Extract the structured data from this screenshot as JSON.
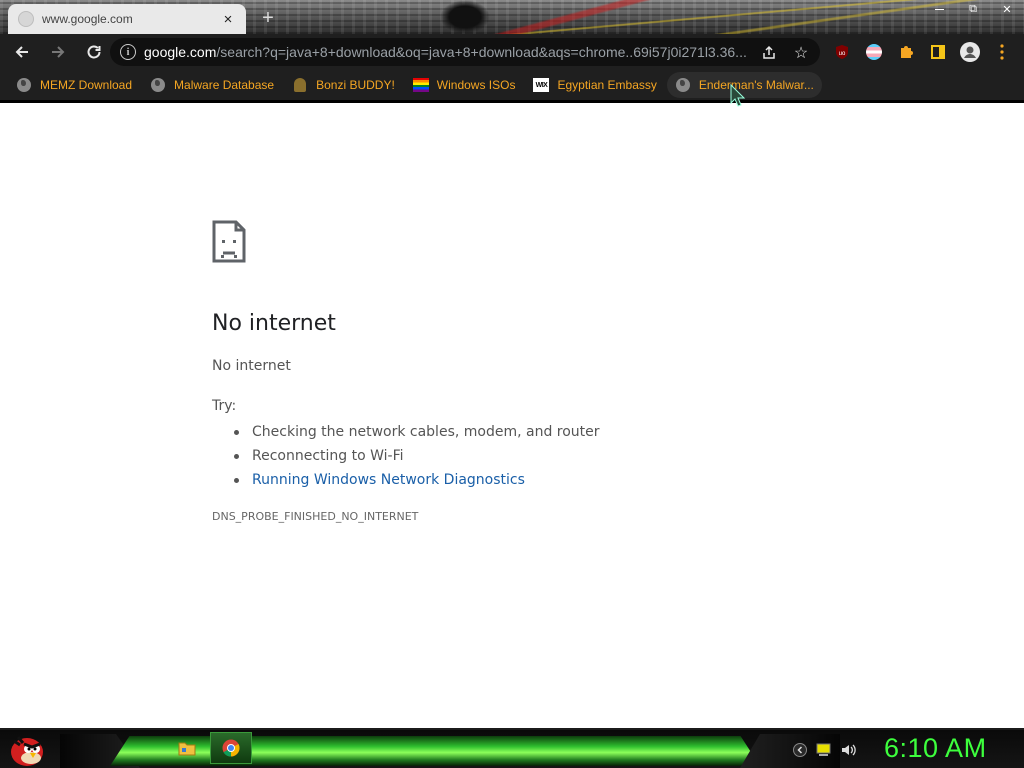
{
  "browser": {
    "tab": {
      "title": "www.google.com",
      "close": "×"
    },
    "new_tab": "+",
    "window_controls": {
      "restore": "⧉",
      "close": "✕"
    },
    "omnibox": {
      "host": "google.com",
      "path": "/search?q=java+8+download&oq=java+8+download&aqs=chrome..69i57j0i271l3.36..."
    },
    "extensions": [
      "ublock-origin-icon",
      "trans-flag-icon",
      "puzzle-piece-icon",
      "side-panel-icon",
      "profile-icon",
      "kebab-menu-icon"
    ],
    "bookmarks": [
      {
        "label": "MEMZ Download",
        "icon": "globe-icon"
      },
      {
        "label": "Malware Database",
        "icon": "globe-icon"
      },
      {
        "label": "Bonzi BUDDY!",
        "icon": "bonzi-icon"
      },
      {
        "label": "Windows ISOs",
        "icon": "rainbow-flag-icon"
      },
      {
        "label": "Egyptian Embassy",
        "icon": "wix-icon"
      },
      {
        "label": "Enderman's Malwar...",
        "icon": "globe-icon"
      }
    ],
    "wix_text": "WIX"
  },
  "error_page": {
    "title": "No internet",
    "subtitle": "No internet",
    "try_label": "Try:",
    "suggestions": [
      {
        "text": "Checking the network cables, modem, and router",
        "link": false
      },
      {
        "text": "Reconnecting to Wi-Fi",
        "link": false
      },
      {
        "text": "Running Windows Network Diagnostics",
        "link": true
      }
    ],
    "error_code": "DNS_PROBE_FINISHED_NO_INTERNET"
  },
  "taskbar": {
    "clock": "6:10 AM",
    "pinned": [
      "file-explorer-icon",
      "chrome-icon"
    ],
    "tray": [
      "show-hidden-icon",
      "notification-icon",
      "volume-icon"
    ]
  },
  "colors": {
    "bookmark_text": "#f5a623",
    "link": "#1a5fa8",
    "clock": "#3dff3d",
    "toolbar_bg": "#1f1f1f"
  }
}
